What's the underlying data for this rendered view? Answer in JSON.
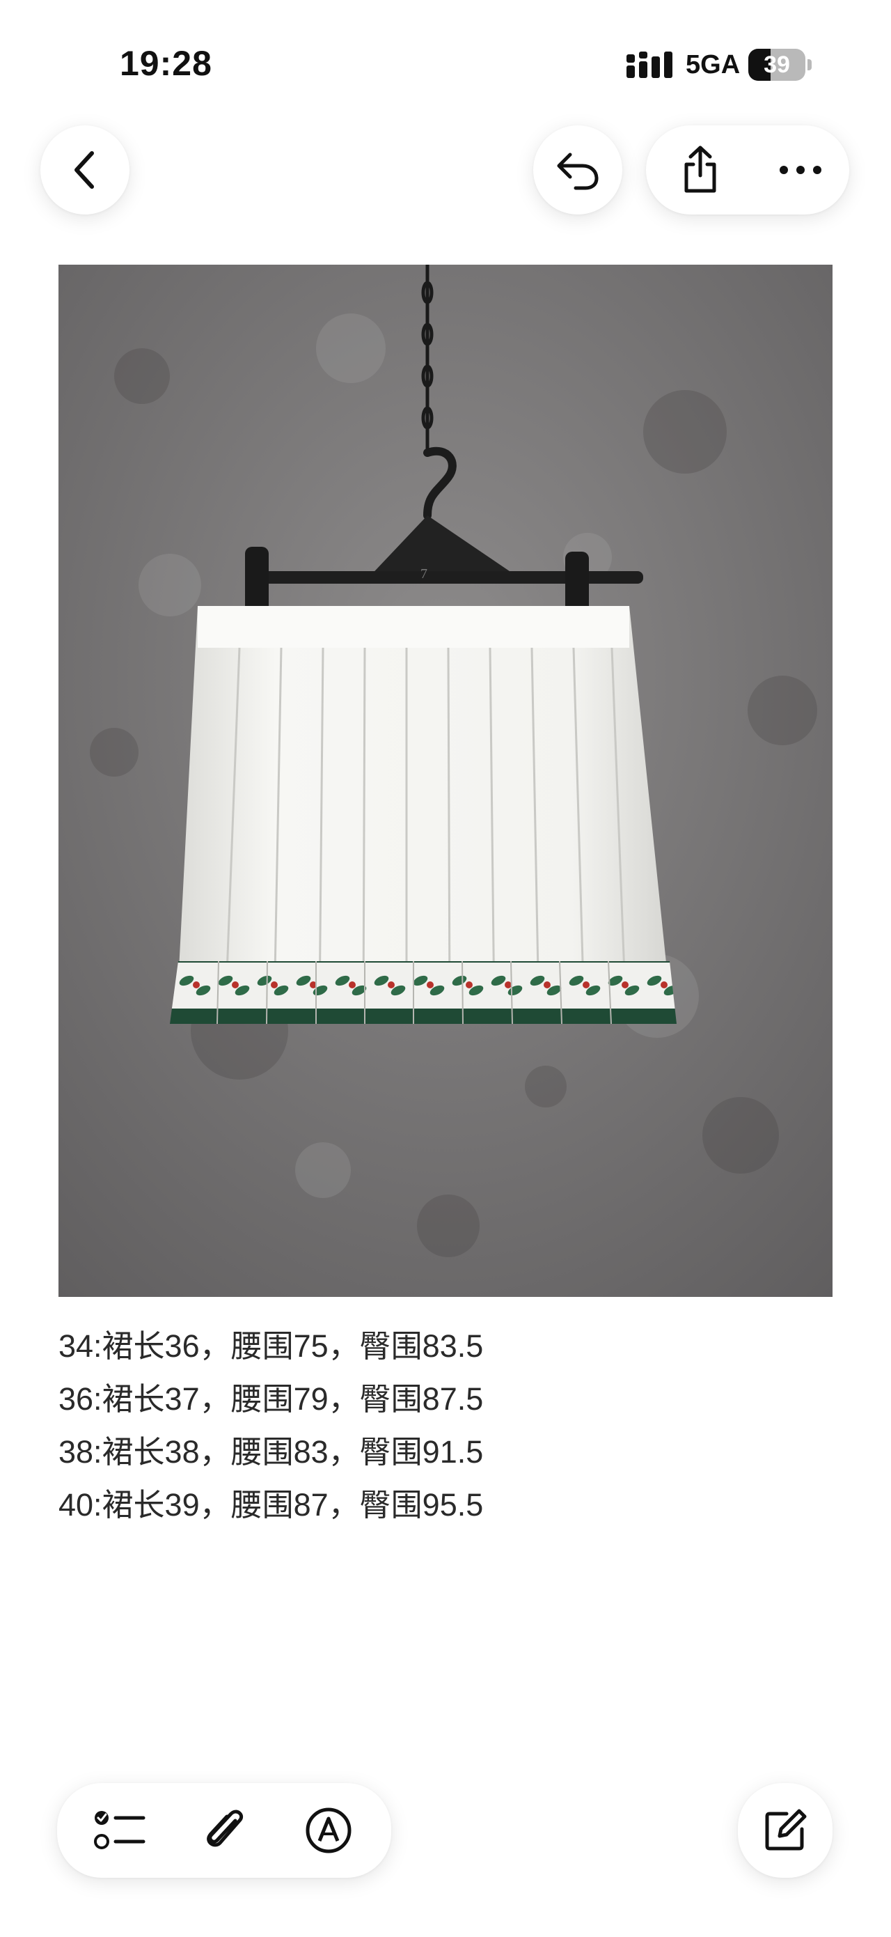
{
  "status_bar": {
    "time": "19:28",
    "network": "5GA",
    "battery_level": "39",
    "battery_fraction": 0.39
  },
  "toolbar": {
    "back_icon": "chevron-left-icon",
    "undo_icon": "undo-icon",
    "share_icon": "share-icon",
    "more_icon": "more-horizontal-icon"
  },
  "photo": {
    "subject": "white pleated skirt with green patterned hem on a hanger against a grey concrete wall",
    "hanger_mark": "7"
  },
  "note": {
    "lines": [
      "34:裙长36，腰围75，臀围83.5",
      "36:裙长37，腰围79，臀围87.5",
      "38:裙长38，腰围83，臀围91.5",
      "40:裙长39，腰围87，臀围95.5"
    ]
  },
  "bottom_toolbar": {
    "checklist_icon": "checklist-icon",
    "attachment_icon": "paperclip-icon",
    "markup_icon": "pen-markup-icon",
    "compose_icon": "compose-icon"
  },
  "colors": {
    "background": "#ffffff",
    "wall": "#7a7878",
    "skirt": "#f6f6f4",
    "hem_green": "#1f4a35",
    "berry_red": "#b8322b"
  }
}
